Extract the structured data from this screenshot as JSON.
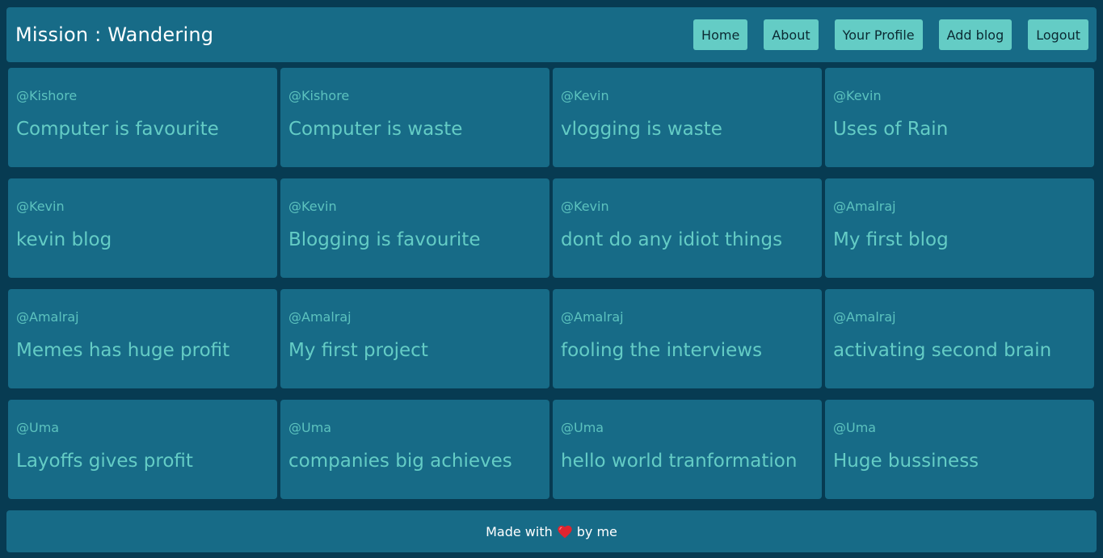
{
  "header": {
    "brand": "Mission : Wandering",
    "nav": [
      "Home",
      "About",
      "Your Profile",
      "Add blog",
      "Logout"
    ]
  },
  "posts": [
    {
      "author": "@Kishore",
      "title": "Computer is favourite"
    },
    {
      "author": "@Kishore",
      "title": "Computer is waste"
    },
    {
      "author": "@Kevin",
      "title": "vlogging is waste"
    },
    {
      "author": "@Kevin",
      "title": "Uses of Rain"
    },
    {
      "author": "@Kevin",
      "title": "kevin blog"
    },
    {
      "author": "@Kevin",
      "title": "Blogging is favourite"
    },
    {
      "author": "@Kevin",
      "title": "dont do any idiot things"
    },
    {
      "author": "@Amalraj",
      "title": "My first blog"
    },
    {
      "author": "@Amalraj",
      "title": "Memes has huge profit"
    },
    {
      "author": "@Amalraj",
      "title": "My first project"
    },
    {
      "author": "@Amalraj",
      "title": "fooling the interviews"
    },
    {
      "author": "@Amalraj",
      "title": "activating second brain"
    },
    {
      "author": "@Uma",
      "title": "Layoffs gives profit"
    },
    {
      "author": "@Uma",
      "title": "companies big achieves"
    },
    {
      "author": "@Uma",
      "title": "hello world tranformation"
    },
    {
      "author": "@Uma",
      "title": "Huge bussiness"
    }
  ],
  "footer": {
    "prefix": "Made with",
    "icon": "heart-icon",
    "suffix": "by me"
  },
  "colors": {
    "background": "#073b52",
    "panel": "#176b87",
    "accent": "#64ccc5",
    "heart": "#e0242f"
  }
}
